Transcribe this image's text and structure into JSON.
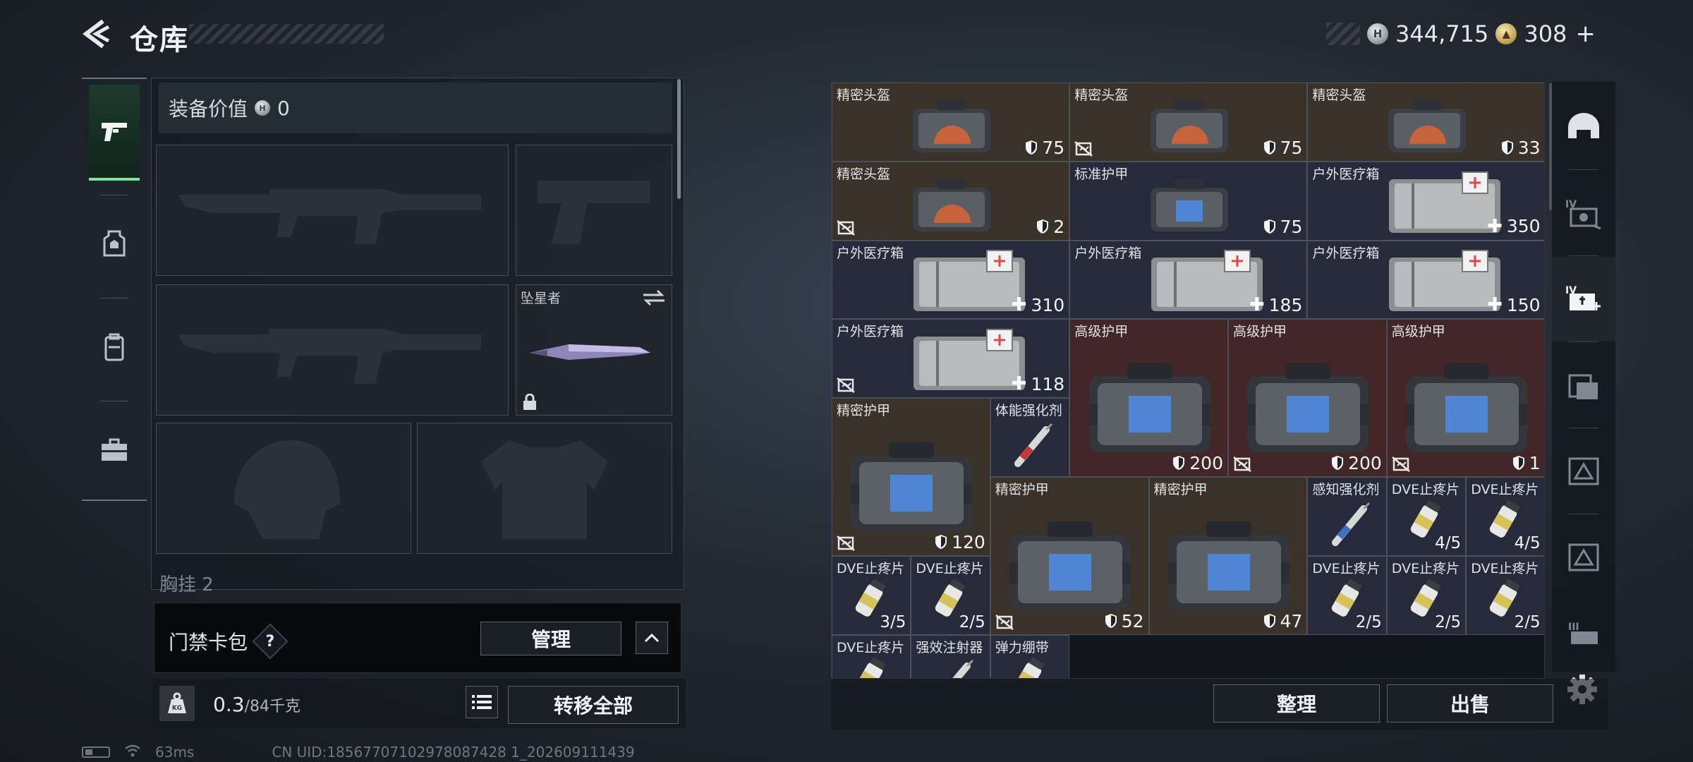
{
  "header": {
    "title": "仓库",
    "currency_silver": "344,715",
    "currency_gold": "308"
  },
  "equipment": {
    "value_label": "装备价值",
    "value": "0",
    "melee_label": "坠星者",
    "partial_label": "胸挂 2"
  },
  "card_bar": {
    "label": "门禁卡包",
    "help": "?",
    "manage_label": "管理"
  },
  "weight": {
    "current": "0.3",
    "max_unit": "/84千克",
    "transfer_label": "转移全部"
  },
  "status": {
    "ping": "63ms",
    "uid": "CN UID:18567707102978087428 1_202609111439"
  },
  "storage": {
    "items": [
      {
        "name": "精密头盔",
        "value": "75",
        "kind": "durability",
        "nolock": false
      },
      {
        "name": "精密头盔",
        "value": "75",
        "kind": "durability",
        "nolock": true
      },
      {
        "name": "精密头盔",
        "value": "33",
        "kind": "durability",
        "nolock": false
      },
      {
        "name": "精密头盔",
        "value": "2",
        "kind": "durability",
        "nolock": true
      },
      {
        "name": "标准护甲",
        "value": "75",
        "kind": "durability",
        "nolock": false
      },
      {
        "name": "户外医疗箱",
        "value": "350",
        "kind": "heal",
        "nolock": false
      },
      {
        "name": "户外医疗箱",
        "value": "310",
        "kind": "heal",
        "nolock": false
      },
      {
        "name": "户外医疗箱",
        "value": "185",
        "kind": "heal",
        "nolock": false
      },
      {
        "name": "户外医疗箱",
        "value": "150",
        "kind": "heal",
        "nolock": false
      },
      {
        "name": "户外医疗箱",
        "value": "118",
        "kind": "heal",
        "nolock": true
      },
      {
        "name": "高级护甲",
        "value": "200",
        "kind": "durability",
        "nolock": false
      },
      {
        "name": "高级护甲",
        "value": "200",
        "kind": "durability",
        "nolock": true
      },
      {
        "name": "高级护甲",
        "value": "1",
        "kind": "durability",
        "nolock": true
      },
      {
        "name": "精密护甲",
        "value": "120",
        "kind": "durability",
        "nolock": true
      },
      {
        "name": "体能强化剂",
        "value": "",
        "kind": "none",
        "nolock": false
      },
      {
        "name": "精密护甲",
        "value": "52",
        "kind": "durability",
        "nolock": true
      },
      {
        "name": "精密护甲",
        "value": "47",
        "kind": "durability",
        "nolock": false
      },
      {
        "name": "感知强化剂",
        "value": "",
        "kind": "none",
        "nolock": false
      },
      {
        "name": "DVE止疼片",
        "value": "4/5",
        "kind": "count",
        "nolock": false
      },
      {
        "name": "DVE止疼片",
        "value": "4/5",
        "kind": "count",
        "nolock": false
      },
      {
        "name": "DVE止疼片",
        "value": "3/5",
        "kind": "count",
        "nolock": false
      },
      {
        "name": "DVE止疼片",
        "value": "2/5",
        "kind": "count",
        "nolock": false
      },
      {
        "name": "DVE止疼片",
        "value": "2/5",
        "kind": "count",
        "nolock": false
      },
      {
        "name": "DVE止疼片",
        "value": "2/5",
        "kind": "count",
        "nolock": false
      },
      {
        "name": "DVE止疼片",
        "value": "2/5",
        "kind": "count",
        "nolock": false
      },
      {
        "name": "DVE止疼片",
        "value": "",
        "kind": "none",
        "nolock": false
      },
      {
        "name": "强效注射器",
        "value": "",
        "kind": "none",
        "nolock": false
      },
      {
        "name": "弹力绷带",
        "value": "",
        "kind": "none",
        "nolock": false
      }
    ]
  },
  "actions": {
    "sort_label": "整理",
    "sell_label": "出售"
  }
}
